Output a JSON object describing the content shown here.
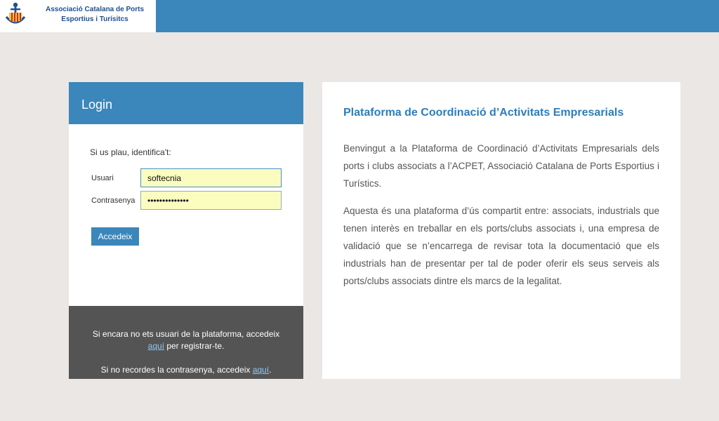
{
  "header": {
    "logo_alt": "anchor-logo-icon",
    "org_line1": "Associació Catalana de Ports",
    "org_line2": "Esportius i Turísitcs"
  },
  "login": {
    "title": "Login",
    "prompt": "Si us plau, identifica't:",
    "username_label": "Usuari",
    "username_value": "softecnia",
    "password_label": "Contrasenya",
    "password_value": "••••••••••••••",
    "submit_label": "Accedeix",
    "footer": {
      "register_pre": "Si encara no ets usuari de la plataforma, accedeix",
      "register_link": "aquí",
      "register_post": " per registrar-te.",
      "forgot_pre": "Si no recordes la contrasenya, accedeix ",
      "forgot_link": "aquí",
      "forgot_post": "."
    }
  },
  "info": {
    "title": "Plataforma de Coordinació d’Activitats Empresarials",
    "paragraph1": "Benvingut a la Plataforma de Coordinació d’Activitats Empresarials dels ports i clubs associats a l’ACPET, Associació Catalana de Ports Esportius i Turístics.",
    "paragraph2": "Aquesta és una plataforma d’ús compartit entre: associats, industrials que tenen interès en treballar en els ports/clubs associats i, una empresa de validació que se n’encarrega de revisar tota la documentació que els industrials han de presentar per tal de poder oferir els seus serveis als ports/clubs associats dintre els marcs de la legalitat."
  },
  "colors": {
    "brand_blue": "#3b86bb",
    "page_bg": "#ebe7e4",
    "footer_bg": "#545454",
    "input_bg": "#fafdbf"
  }
}
